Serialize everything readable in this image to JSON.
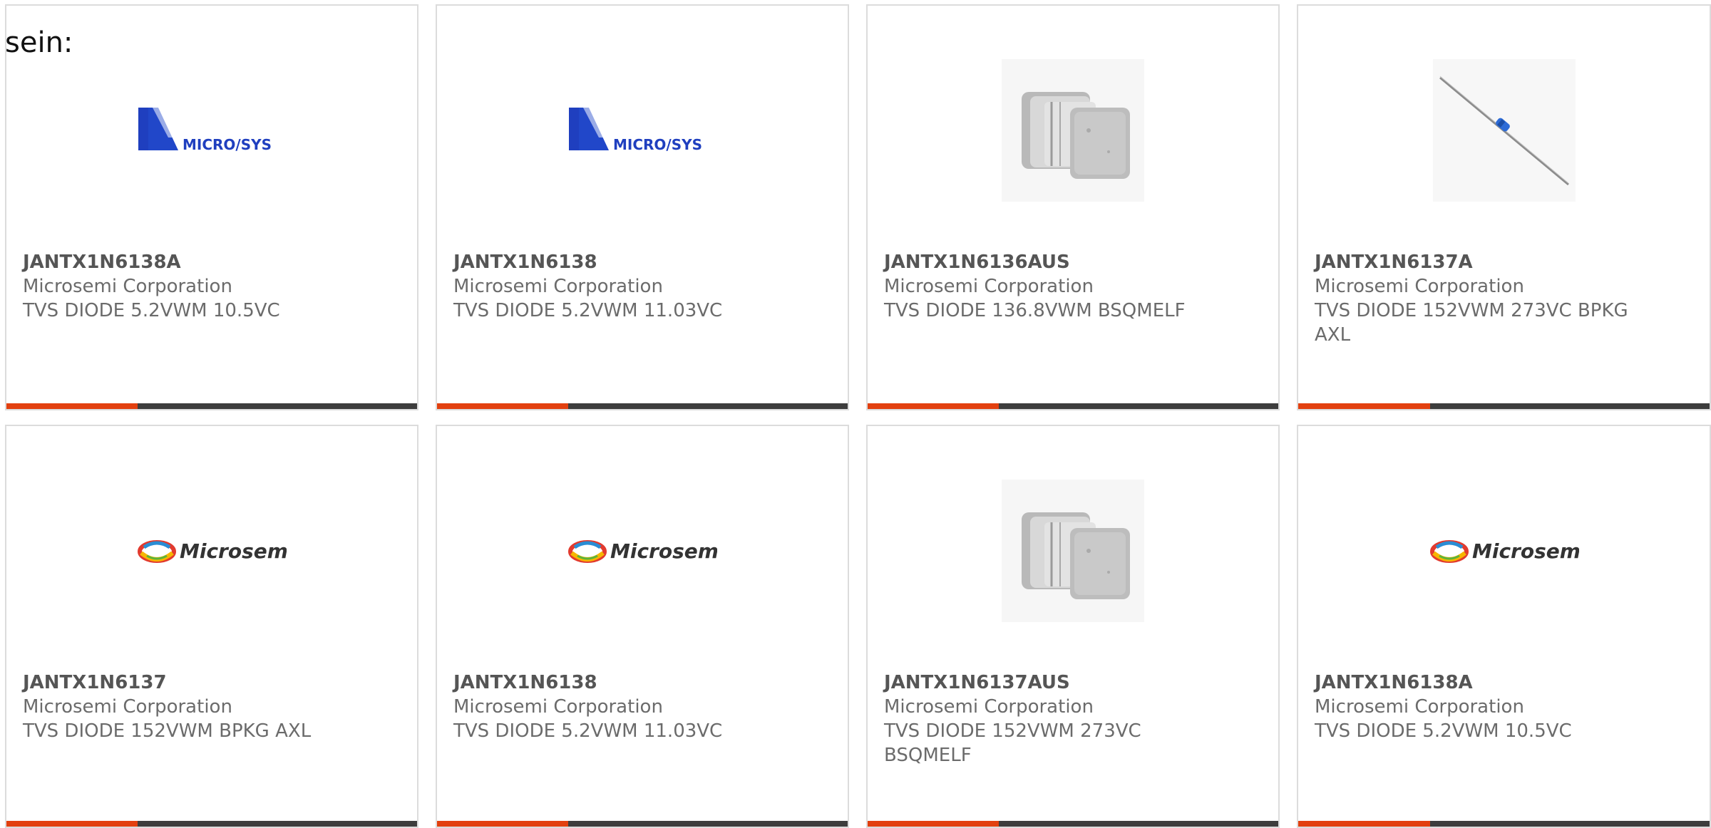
{
  "intro_text": "sein:",
  "colors": {
    "accent": "#e2400f",
    "bar": "#3d3d3d",
    "card_border": "#dcdcdc",
    "text": "#6b6b6b",
    "part_text": "#555555"
  },
  "cards": [
    {
      "part": "JANTX1N6138A",
      "manufacturer": "Microsemi Corporation",
      "description": "TVS DIODE 5.2VWM 10.5VC",
      "image": "micro-sys-logo",
      "logo_text": "MICRO/SYS"
    },
    {
      "part": "JANTX1N6138",
      "manufacturer": "Microsemi Corporation",
      "description": "TVS DIODE 5.2VWM 11.03VC",
      "image": "micro-sys-logo",
      "logo_text": "MICRO/SYS"
    },
    {
      "part": "JANTX1N6136AUS",
      "manufacturer": "Microsemi Corporation",
      "description": "TVS DIODE 136.8VWM BSQMELF",
      "image": "melf-package-photo"
    },
    {
      "part": "JANTX1N6137A",
      "manufacturer": "Microsemi Corporation",
      "description": "TVS DIODE 152VWM 273VC BPKG AXL",
      "image": "axial-diode-photo"
    },
    {
      "part": "JANTX1N6137",
      "manufacturer": "Microsemi Corporation",
      "description": "TVS DIODE 152VWM BPKG AXL",
      "image": "microsemi-logo",
      "logo_text": "Microsemi"
    },
    {
      "part": "JANTX1N6138",
      "manufacturer": "Microsemi Corporation",
      "description": "TVS DIODE 5.2VWM 11.03VC",
      "image": "microsemi-logo",
      "logo_text": "Microsemi"
    },
    {
      "part": "JANTX1N6137AUS",
      "manufacturer": "Microsemi Corporation",
      "description": "TVS DIODE 152VWM 273VC BSQMELF",
      "image": "melf-package-photo"
    },
    {
      "part": "JANTX1N6138A",
      "manufacturer": "Microsemi Corporation",
      "description": "TVS DIODE 5.2VWM 10.5VC",
      "image": "microsemi-logo",
      "logo_text": "Microsemi"
    }
  ]
}
